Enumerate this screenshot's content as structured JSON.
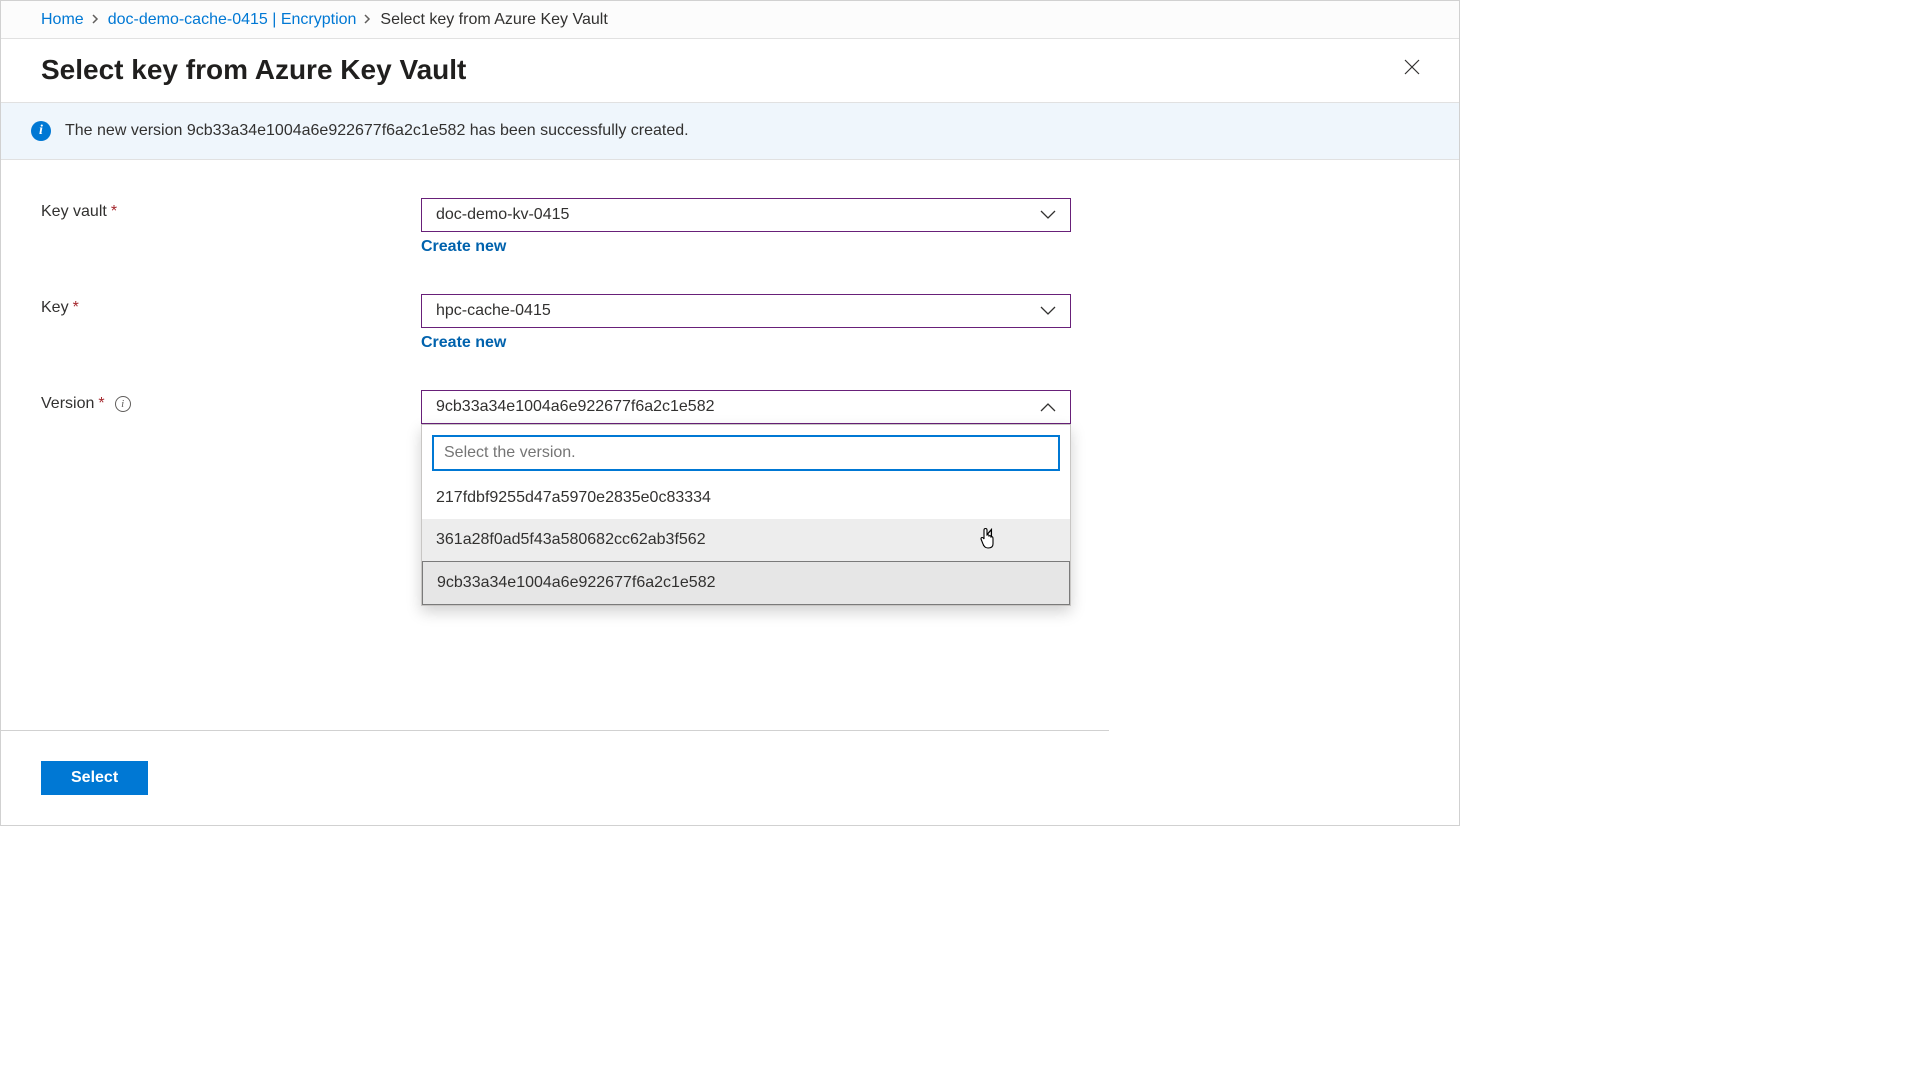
{
  "breadcrumb": {
    "home": "Home",
    "resource": "doc-demo-cache-0415 | Encryption",
    "current": "Select key from Azure Key Vault"
  },
  "panel": {
    "title": "Select key from Azure Key Vault"
  },
  "info": {
    "message": "The new version 9cb33a34e1004a6e922677f6a2c1e582 has been successfully created."
  },
  "form": {
    "key_vault": {
      "label": "Key vault",
      "value": "doc-demo-kv-0415",
      "create_new": "Create new"
    },
    "key": {
      "label": "Key",
      "value": "hpc-cache-0415",
      "create_new": "Create new"
    },
    "version": {
      "label": "Version",
      "value": "9cb33a34e1004a6e922677f6a2c1e582",
      "search_placeholder": "Select the version.",
      "options": [
        "217fdbf9255d47a5970e2835e0c83334",
        "361a28f0ad5f43a580682cc62ab3f562",
        "9cb33a34e1004a6e922677f6a2c1e582"
      ]
    }
  },
  "footer": {
    "select_button": "Select"
  }
}
